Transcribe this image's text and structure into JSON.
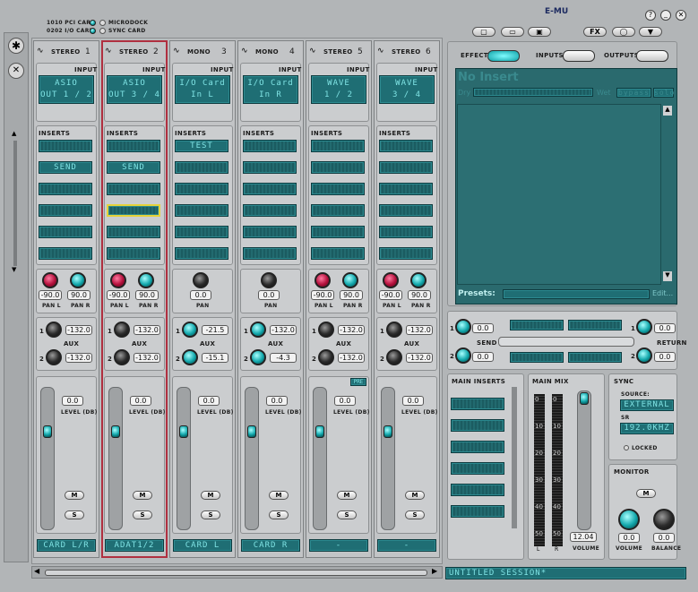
{
  "header": {
    "pci_card": "1010 PCI CARD",
    "io_card": "0202 I/O CARD",
    "microdock": "MICRODOCK",
    "sync_card": "SYNC CARD",
    "brand": "E-MU",
    "help": "?",
    "fx_label": "FX"
  },
  "section_labels": {
    "input": "INPUT",
    "inserts": "INSERTS",
    "pan_l": "PAN L",
    "pan_r": "PAN R",
    "pan": "PAN",
    "aux": "AUX",
    "level": "LEVEL (DB)",
    "mute": "M",
    "solo": "S",
    "pre": "PRE",
    "aux1": "1",
    "aux2": "2"
  },
  "channels": [
    {
      "type": "STEREO",
      "number": "1",
      "input_line1": "ASIO",
      "input_line2": "OUT 1 / 2",
      "inserts": [
        "",
        "SEND",
        "",
        "",
        "",
        ""
      ],
      "pan_l": "-90.0",
      "pan_r": "90.0",
      "aux1": "-132.0",
      "aux2": "-132.0",
      "level": "0.0",
      "output": "CARD L/R"
    },
    {
      "type": "STEREO",
      "number": "2",
      "input_line1": "ASIO",
      "input_line2": "OUT 3 / 4",
      "inserts": [
        "",
        "SEND",
        "",
        "",
        "",
        ""
      ],
      "pan_l": "-90.0",
      "pan_r": "90.0",
      "aux1": "-132.0",
      "aux2": "-132.0",
      "level": "0.0",
      "output": "ADAT1/2"
    },
    {
      "type": "MONO",
      "number": "3",
      "input_line1": "I/O Card",
      "input_line2": "In L",
      "inserts": [
        "TEST",
        "",
        "",
        "",
        "",
        ""
      ],
      "pan": "0.0",
      "aux1": "-21.5",
      "aux2": "-15.1",
      "level": "0.0",
      "output": "CARD L"
    },
    {
      "type": "MONO",
      "number": "4",
      "input_line1": "I/O Card",
      "input_line2": "In R",
      "inserts": [
        "",
        "",
        "",
        "",
        "",
        ""
      ],
      "pan": "0.0",
      "aux1": "-132.0",
      "aux2": "-4.3",
      "level": "0.0",
      "output": "CARD R"
    },
    {
      "type": "STEREO",
      "number": "5",
      "input_line1": "WAVE",
      "input_line2": "1 / 2",
      "inserts": [
        "",
        "",
        "",
        "",
        "",
        ""
      ],
      "pan_l": "-90.0",
      "pan_r": "90.0",
      "aux1": "-132.0",
      "aux2": "-132.0",
      "level": "0.0",
      "output": "-"
    },
    {
      "type": "STEREO",
      "number": "6",
      "input_line1": "WAVE",
      "input_line2": "3 / 4",
      "inserts": [
        "",
        "",
        "",
        "",
        "",
        ""
      ],
      "pan_l": "-90.0",
      "pan_r": "90.0",
      "aux1": "-132.0",
      "aux2": "-132.0",
      "level": "0.0",
      "output": "-"
    }
  ],
  "right_panel": {
    "effect_tab": "EFFECT",
    "inputs_tab": "INPUTS",
    "outputs_tab": "OUTPUTS",
    "insert_name": "No Insert",
    "dry": "Dry",
    "wet": "Wet",
    "bypass": "bypass",
    "solo": "solo",
    "presets": "Presets:",
    "edit": "Edit..."
  },
  "send_return": {
    "send": "SEND",
    "return": "RETURN",
    "send1": "0.0",
    "send2": "0.0",
    "return1": "0.0",
    "return2": "0.0",
    "n1": "1",
    "n2": "2"
  },
  "main_inserts": {
    "title": "MAIN INSERTS"
  },
  "main_mix": {
    "title": "MAIN MIX",
    "scale": [
      "0",
      "10",
      "20",
      "30",
      "40",
      "50"
    ],
    "l": "L",
    "r": "R",
    "volume": "12.04",
    "volume_label": "VOLUME"
  },
  "sync": {
    "title": "SYNC",
    "source_label": "SOURCE:",
    "source": "EXTERNAL",
    "sr_label": "SR",
    "sr": "192.0KHZ",
    "locked": "LOCKED"
  },
  "monitor": {
    "title": "MONITOR",
    "mute": "M",
    "volume": "0.0",
    "balance": "0.0",
    "volume_label": "VOLUME",
    "balance_label": "BALANCE"
  },
  "session": "UNTITLED SESSION*",
  "colors": {
    "lcd": "#1f6e74",
    "lcd_text": "#7fe3e4",
    "selected_border": "#b03040",
    "background": "#b2b5b7"
  }
}
